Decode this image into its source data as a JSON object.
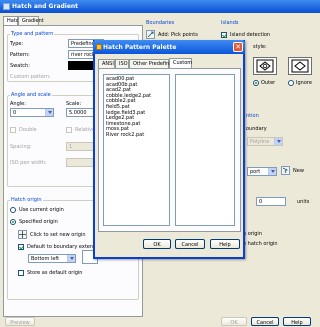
{
  "window": {
    "title": "Hatch and Gradient"
  },
  "tabs": [
    {
      "label": "Hatch"
    },
    {
      "label": "Gradient"
    }
  ],
  "type_pattern": {
    "group_title": "Type and pattern",
    "type_label": "Type:",
    "type_value": "Predefined",
    "pattern_label": "Pattern:",
    "pattern_value": "river rock2",
    "swatch_label": "Swatch:",
    "custom_label": "Custom pattern:"
  },
  "angle_scale": {
    "group_title": "Angle and scale",
    "angle_label": "Angle:",
    "angle_value": "0",
    "scale_label": "Scale:",
    "scale_value": "5.0000",
    "double_label": "Double",
    "relative_label": "Relative to paper space",
    "spacing_label": "Spacing:",
    "spacing_value": "1",
    "iso_label": "ISO pen width:"
  },
  "hatch_origin": {
    "group_title": "Hatch origin",
    "use_current": "Use current origin",
    "specified": "Specified origin",
    "click_set": "Click to set new origin",
    "default_extents": "Default to boundary extents",
    "position_value": "Bottom left",
    "store_default": "Store as default origin"
  },
  "boundaries": {
    "group_title": "Boundaries",
    "add_pick": "Add: Pick points"
  },
  "islands": {
    "group_title": "Islands",
    "island_detection": "Island detection",
    "display_style": "style:",
    "outer": "Outer",
    "ignore": "Ignore"
  },
  "right_misc": {
    "retention_title": "ntion",
    "boundary_label": "oundary",
    "polyline_value": "Polyline",
    "viewport_value": "port",
    "new_label": "New",
    "tolerance_value": "0",
    "units_label": "units",
    "origin_text1": "n origin",
    "origin_text2": "e hatch origin"
  },
  "bottom": {
    "preview": "Preview",
    "ok": "OK",
    "cancel": "Cancel",
    "help": "Help"
  },
  "palette": {
    "title": "Hatch Pattern Palette",
    "close_glyph": "✕",
    "tabs": [
      "ANSI",
      "ISO",
      "Other Predefined",
      "Custom"
    ],
    "patterns": [
      "acad00.pat",
      "acad00b.pat",
      "acad2.pat",
      "cobble.ledge2.pat",
      "cobble2.pat",
      "field5.pat",
      "ledge.field3.pat",
      "Ledge2.pat",
      "limestone.pat",
      "moss.pat",
      "River rock2.pat"
    ],
    "ok": "OK",
    "cancel": "Cancel",
    "help": "Help"
  },
  "colors": {
    "title_bar": "#0a4fd1",
    "accent_blue": "#0046d5",
    "window_bg": "#ece9d8",
    "close_red": "#e05a37"
  }
}
